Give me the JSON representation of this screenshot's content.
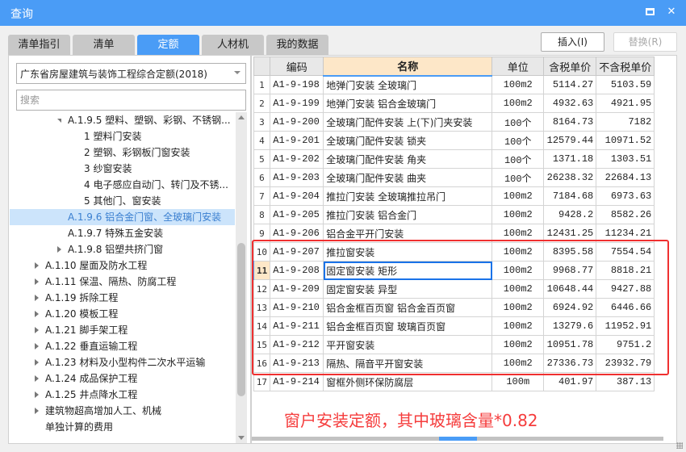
{
  "window": {
    "title": "查询",
    "maximize_icon": "maximize-icon",
    "close_icon": "close-icon",
    "close_label": "✕"
  },
  "tabs": [
    {
      "label": "清单指引"
    },
    {
      "label": "清单"
    },
    {
      "label": "定额",
      "active": true
    },
    {
      "label": "人材机"
    },
    {
      "label": "我的数据"
    }
  ],
  "toolbar": {
    "insert_label": "插入(I)",
    "replace_label": "替换(R)"
  },
  "left": {
    "library_select": "广东省房屋建筑与装饰工程综合定额(2018)",
    "search_placeholder": "搜索",
    "tree": [
      {
        "label": "A.1.9.5 塑料、塑钢、彩钢、不锈钢...",
        "level": 2,
        "toggle": "expanded"
      },
      {
        "label": "1 塑料门安装",
        "level": 3
      },
      {
        "label": "2 塑钢、彩钢板门窗安装",
        "level": 3
      },
      {
        "label": "3 纱窗安装",
        "level": 3
      },
      {
        "label": "4 电子感应自动门、转门及不锈...",
        "level": 3
      },
      {
        "label": "5 其他门、窗安装",
        "level": 3
      },
      {
        "label": "A.1.9.6 铝合金门窗、全玻璃门安装",
        "level": 2,
        "selected": true
      },
      {
        "label": "A.1.9.7 特殊五金安装",
        "level": 2
      },
      {
        "label": "A.1.9.8 铝塑共挤门窗",
        "level": 2,
        "toggle": "collapsed"
      },
      {
        "label": "A.1.10 屋面及防水工程",
        "level": 1,
        "toggle": "collapsed"
      },
      {
        "label": "A.1.11 保温、隔热、防腐工程",
        "level": 1,
        "toggle": "collapsed"
      },
      {
        "label": "A.1.19 拆除工程",
        "level": 1,
        "toggle": "collapsed"
      },
      {
        "label": "A.1.20 模板工程",
        "level": 1,
        "toggle": "collapsed"
      },
      {
        "label": "A.1.21 脚手架工程",
        "level": 1,
        "toggle": "collapsed"
      },
      {
        "label": "A.1.22 垂直运输工程",
        "level": 1,
        "toggle": "collapsed"
      },
      {
        "label": "A.1.23 材料及小型构件二次水平运输",
        "level": 1,
        "toggle": "collapsed"
      },
      {
        "label": "A.1.24 成品保护工程",
        "level": 1,
        "toggle": "collapsed"
      },
      {
        "label": "A.1.25 井点降水工程",
        "level": 1,
        "toggle": "collapsed"
      },
      {
        "label": "建筑物超高增加人工、机械",
        "level": 1,
        "toggle": "collapsed"
      },
      {
        "label": "单独计算的费用",
        "level": 1
      }
    ]
  },
  "table": {
    "headers": [
      "",
      "编码",
      "名称",
      "单位",
      "含税单价",
      "不含税单价"
    ],
    "current_row": 11,
    "rows": [
      {
        "no": "1",
        "code": "A1-9-198",
        "name": "地弹门安装 全玻璃门",
        "unit": "100m2",
        "tax": "5114.27",
        "notax": "5103.59"
      },
      {
        "no": "2",
        "code": "A1-9-199",
        "name": "地弹门安装 铝合金玻璃门",
        "unit": "100m2",
        "tax": "4932.63",
        "notax": "4921.95"
      },
      {
        "no": "3",
        "code": "A1-9-200",
        "name": "全玻璃门配件安装 上(下)门夹安装",
        "unit": "100个",
        "tax": "8164.73",
        "notax": "7182"
      },
      {
        "no": "4",
        "code": "A1-9-201",
        "name": "全玻璃门配件安装 锁夹",
        "unit": "100个",
        "tax": "12579.44",
        "notax": "10971.52"
      },
      {
        "no": "5",
        "code": "A1-9-202",
        "name": "全玻璃门配件安装 角夹",
        "unit": "100个",
        "tax": "1371.18",
        "notax": "1303.51"
      },
      {
        "no": "6",
        "code": "A1-9-203",
        "name": "全玻璃门配件安装 曲夹",
        "unit": "100个",
        "tax": "26238.32",
        "notax": "22684.13"
      },
      {
        "no": "7",
        "code": "A1-9-204",
        "name": "推拉门安装 全玻璃推拉吊门",
        "unit": "100m2",
        "tax": "7184.68",
        "notax": "6973.63"
      },
      {
        "no": "8",
        "code": "A1-9-205",
        "name": "推拉门安装 铝合金门",
        "unit": "100m2",
        "tax": "9428.2",
        "notax": "8582.26"
      },
      {
        "no": "9",
        "code": "A1-9-206",
        "name": "铝合金平开门安装",
        "unit": "100m2",
        "tax": "12431.25",
        "notax": "11234.21"
      },
      {
        "no": "10",
        "code": "A1-9-207",
        "name": "推拉窗安装",
        "unit": "100m2",
        "tax": "8395.58",
        "notax": "7554.54"
      },
      {
        "no": "11",
        "code": "A1-9-208",
        "name": "固定窗安装 矩形",
        "unit": "100m2",
        "tax": "9968.77",
        "notax": "8818.21"
      },
      {
        "no": "12",
        "code": "A1-9-209",
        "name": "固定窗安装 异型",
        "unit": "100m2",
        "tax": "10648.44",
        "notax": "9427.88"
      },
      {
        "no": "13",
        "code": "A1-9-210",
        "name": "铝合金框百页窗 铝合金百页窗",
        "unit": "100m2",
        "tax": "6924.92",
        "notax": "6446.66"
      },
      {
        "no": "14",
        "code": "A1-9-211",
        "name": "铝合金框百页窗 玻璃百页窗",
        "unit": "100m2",
        "tax": "13279.6",
        "notax": "11952.91"
      },
      {
        "no": "15",
        "code": "A1-9-212",
        "name": "平开窗安装",
        "unit": "100m2",
        "tax": "10951.78",
        "notax": "9751.2"
      },
      {
        "no": "16",
        "code": "A1-9-213",
        "name": "隔热、隔音平开窗安装",
        "unit": "100m2",
        "tax": "27336.73",
        "notax": "23932.79"
      },
      {
        "no": "17",
        "code": "A1-9-214",
        "name": "窗框外侧环保防腐层",
        "unit": "100m",
        "tax": "401.97",
        "notax": "387.13"
      }
    ]
  },
  "annotation": {
    "text": "窗户安装定额，其中玻璃含量*0.82",
    "color": "#f53c3c"
  },
  "colors": {
    "accent": "#4a9cf6",
    "highlight": "#fde7c8",
    "selection": "#cce4fb"
  }
}
